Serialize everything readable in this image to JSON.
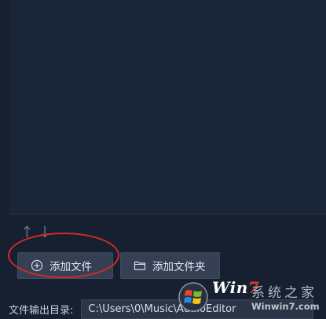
{
  "sort": {
    "up_icon": "arrow-up-icon",
    "down_icon": "arrow-down-icon",
    "up_glyph": "↑",
    "down_glyph": "↓"
  },
  "buttons": {
    "add_file": {
      "label": "添加文件",
      "icon": "plus-circle-icon"
    },
    "add_folder": {
      "label": "添加文件夹",
      "icon": "folder-icon"
    }
  },
  "output": {
    "label": "文件输出目录:",
    "path": "C:\\Users\\0\\Music\\AudioEditor"
  },
  "watermark": {
    "brand_prefix": "Win",
    "brand_number": "7",
    "brand_cn": "系统之家",
    "url": "Winwin7.com"
  },
  "colors": {
    "accent_red": "#d22a2a",
    "button_bg": "#354054",
    "panel_bg": "#1b2538"
  }
}
